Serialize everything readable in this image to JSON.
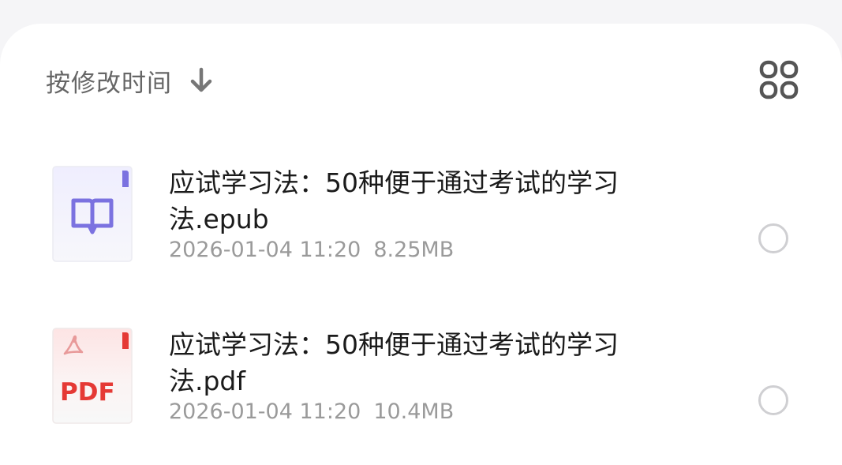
{
  "sort": {
    "label": "按修改时间",
    "arrow_icon": "arrow-down-icon"
  },
  "view_toggle": {
    "icon": "grid-view-icon"
  },
  "files": [
    {
      "name": "应试学习法：50种便于通过考试的学习法.epub",
      "date": "2026-01-04 11:20",
      "size": "8.25MB",
      "icon": "epub-book-icon",
      "accent": "#7b72e0"
    },
    {
      "name": "应试学习法：50种便于通过考试的学习法.pdf",
      "date": "2026-01-04 11:20",
      "size": "10.4MB",
      "icon": "pdf-file-icon",
      "icon_text": "PDF",
      "accent": "#e53935"
    }
  ]
}
